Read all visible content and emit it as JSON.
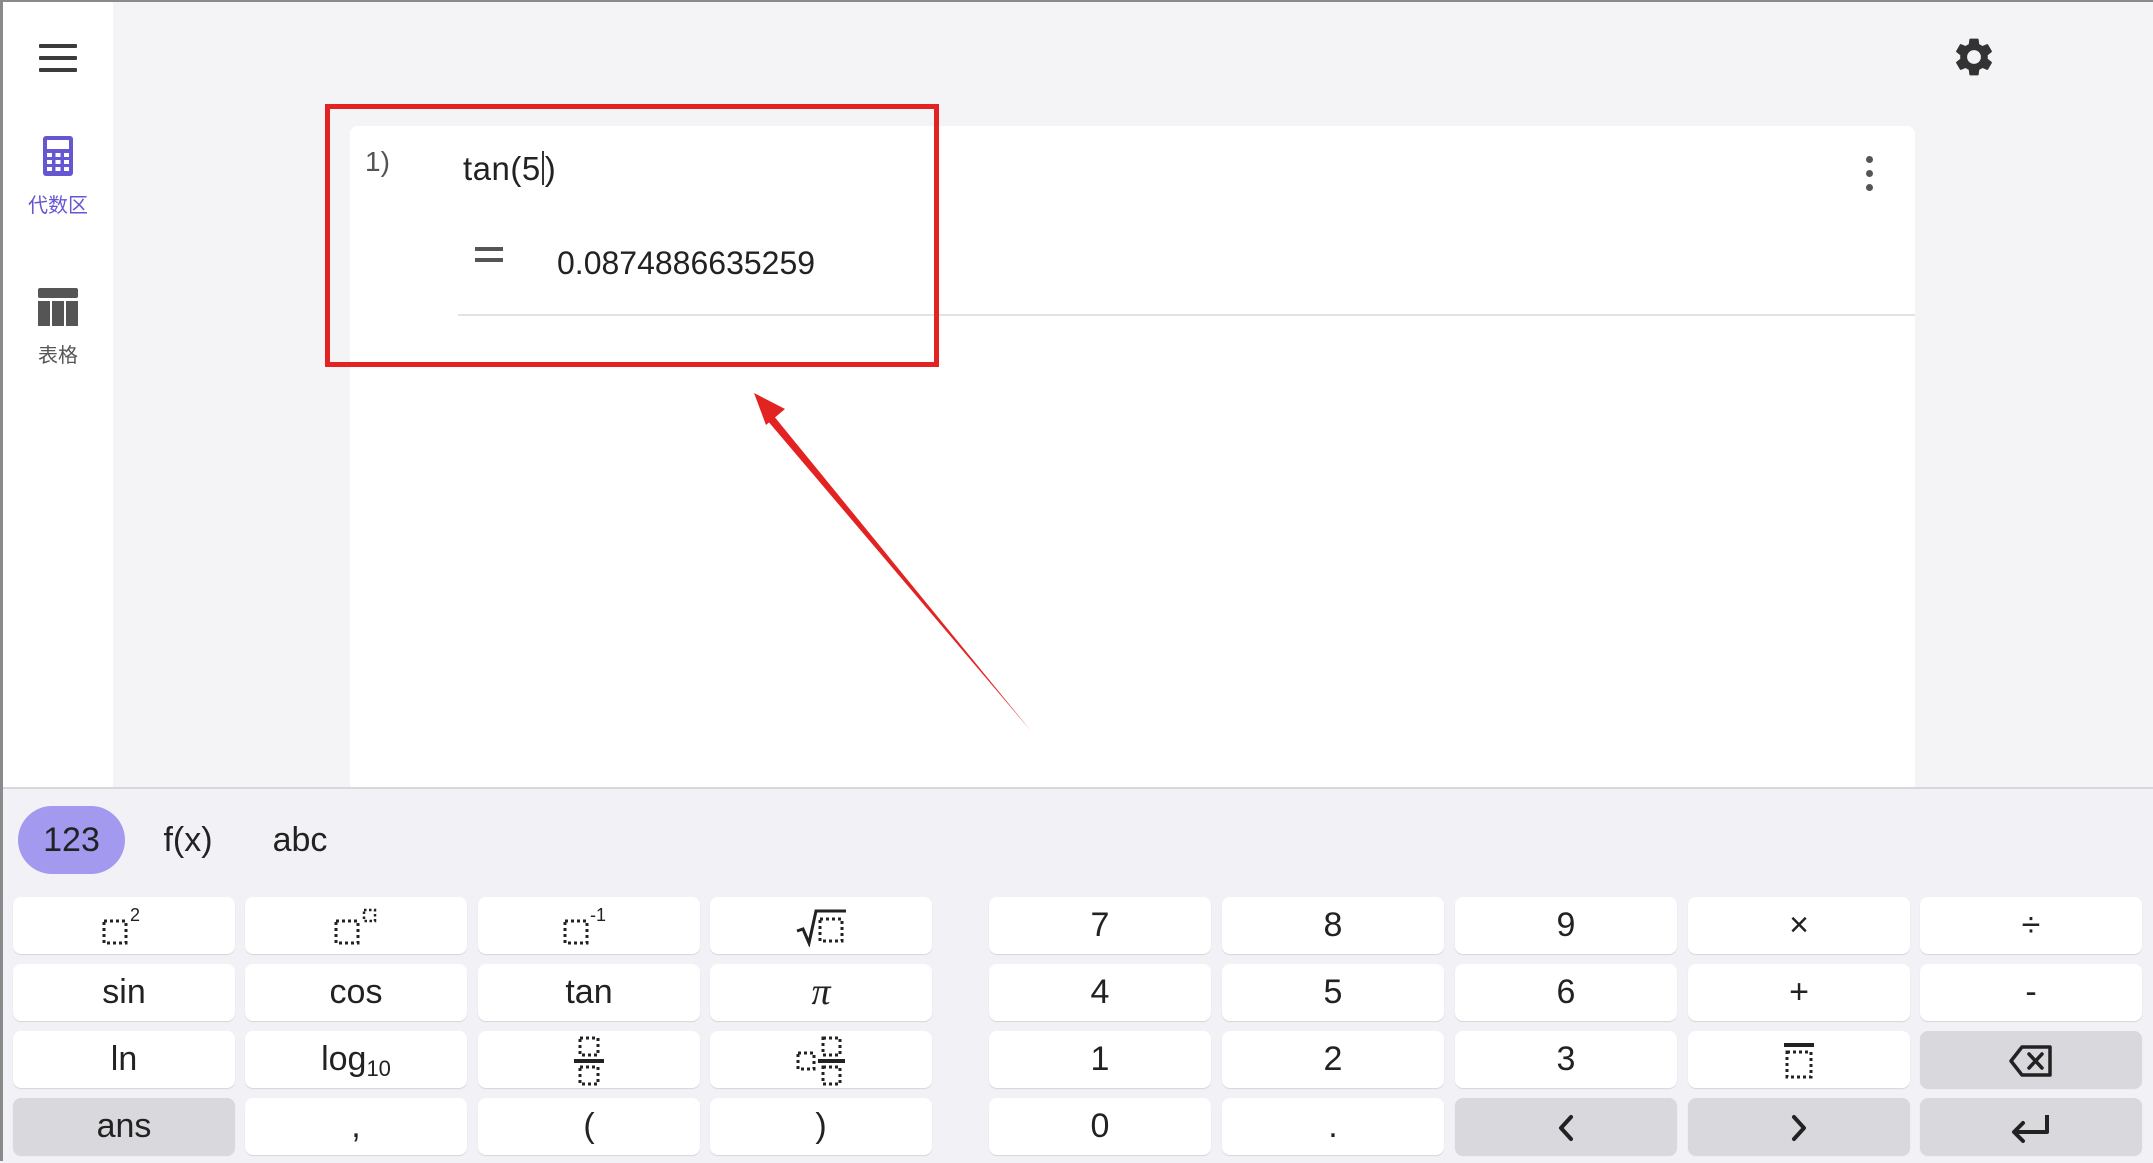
{
  "sidebar": {
    "menu_icon": "hamburger-menu-icon",
    "items": [
      {
        "label": "代数区",
        "icon": "calculator-icon",
        "active": true,
        "color": "#6557d2"
      },
      {
        "label": "表格",
        "icon": "table-icon",
        "active": false
      }
    ]
  },
  "header": {
    "settings_icon": "gear-icon"
  },
  "algebra": {
    "rows": [
      {
        "number": "1)",
        "input_before_cursor": "tan(5",
        "input_after_cursor": ")",
        "equals": "=",
        "result": "0.0874886635259"
      }
    ],
    "more_icon": "vertical-dots-icon"
  },
  "annotation": {
    "box_color": "#e32222",
    "arrow_color": "#e32222"
  },
  "keyboard": {
    "tabs": [
      {
        "label": "123",
        "active": true
      },
      {
        "label": "f(x)",
        "active": false
      },
      {
        "label": "abc",
        "active": false
      }
    ],
    "active_tab_color": "#a39af0",
    "keys": {
      "sin": "sin",
      "cos": "cos",
      "tan": "tan",
      "pi": "π",
      "ln": "ln",
      "log": "log",
      "log_sub": "10",
      "ans": "ans",
      "comma": ",",
      "lparen": "(",
      "rparen": ")",
      "seven": "7",
      "eight": "8",
      "nine": "9",
      "times": "×",
      "divide": "÷",
      "four": "4",
      "five": "5",
      "six": "6",
      "plus": "+",
      "minus": "-",
      "one": "1",
      "two": "2",
      "three": "3",
      "zero": "0",
      "dot": ".",
      "left": "‹",
      "right": "›"
    }
  }
}
